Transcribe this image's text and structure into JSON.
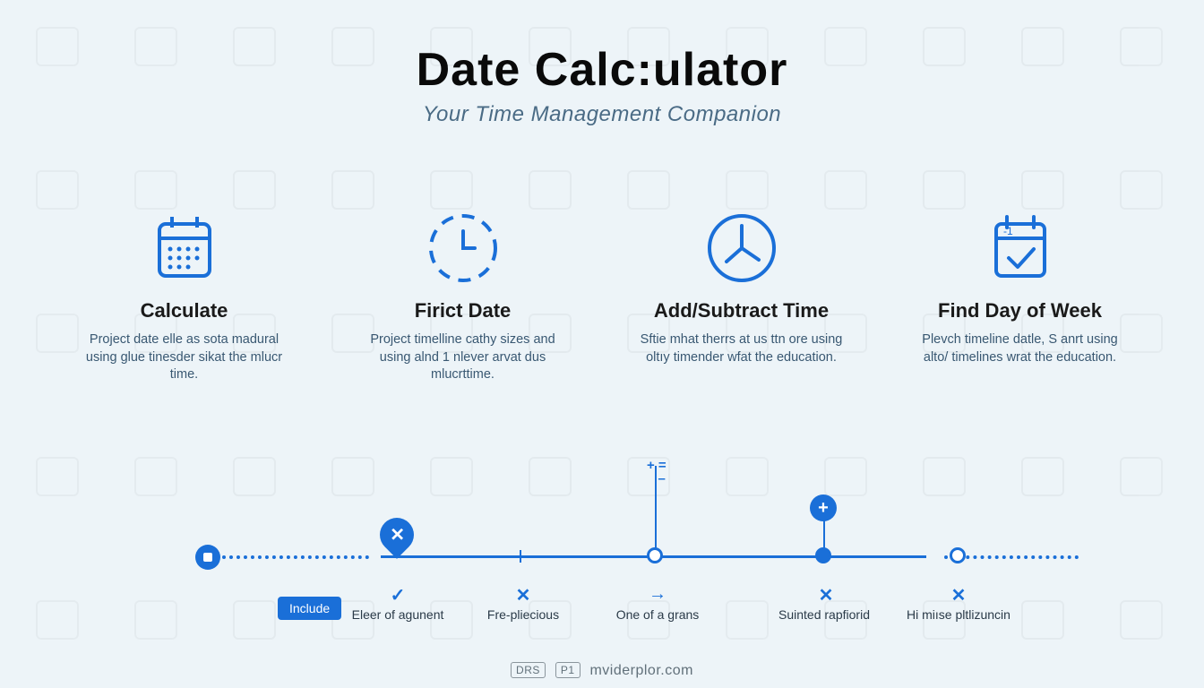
{
  "header": {
    "title": "Date Calc:ulator",
    "subtitle": "Your Time Management Companion"
  },
  "features": [
    {
      "heading": "Calculate",
      "desc": "Project date elle as sota madural using glue tinesder sikat the mlucr time."
    },
    {
      "heading": "Firict Date",
      "desc": "Project timelline cathy sizes and using alnd 1 nlever arvat dus mlucrttime."
    },
    {
      "heading": "Add/Subtract Time",
      "desc": "Sftie mhat therrs at us ttn ore using oltıy timender wfat the education."
    },
    {
      "heading": "Find Day of Week",
      "desc": "Plevch timeline datle, S anrt using alto/ timelines wrat the education."
    }
  ],
  "timeline": {
    "button": "Include",
    "labels": [
      "Eleer of agunent",
      "Fre-pliecious",
      "One of a grans",
      "Suinted rapfiorid",
      "Hi miıse pltlizuncin"
    ]
  },
  "footer": {
    "badge1": "DRS",
    "badge2": "P1",
    "site": "mviderplor.com"
  }
}
